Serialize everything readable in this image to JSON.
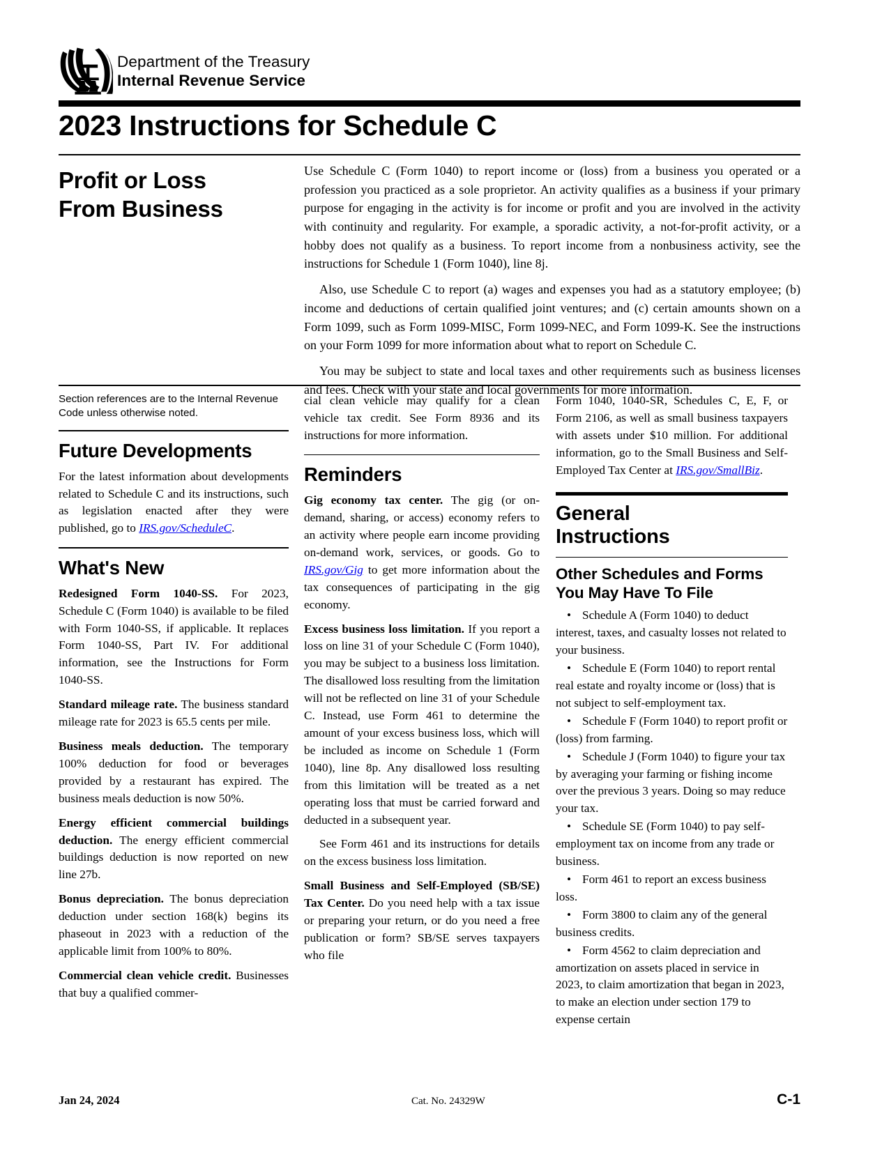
{
  "header": {
    "department": "Department of the Treasury",
    "agency": "Internal Revenue Service",
    "seal_icon": "irs-eagle-seal-icon"
  },
  "title": "2023 Instructions for Schedule C",
  "subtitle": "Profit or Loss\nFrom Business",
  "intro": {
    "p1": "Use Schedule C (Form 1040) to report income or (loss) from a business you operated or a profession you practiced as a sole proprietor. An activity qualifies as a business if your primary purpose for engaging in the activity is for income or profit and you are involved in the activity with continuity and regularity. For example, a sporadic activity, a not-for-profit activity, or a hobby does not qualify as a business. To report income from a nonbusiness activity, see the instructions for Schedule 1 (Form 1040), line 8j.",
    "p2": "Also, use Schedule C to report (a) wages and expenses you had as a statutory employee; (b) income and deductions of certain qualified joint ventures; and (c) certain amounts shown on a Form 1099, such as Form 1099-MISC, Form 1099-NEC, and Form 1099-K. See the instructions on your Form 1099 for more information about what to report on Schedule C.",
    "p3": "You may be subject to state and local taxes and other requirements such as business licenses and fees. Check with your state and local governments for more information."
  },
  "column1": {
    "section_note": "Section references are to the Internal Revenue Code unless otherwise noted.",
    "future_developments_heading": "Future Developments",
    "future_developments_text_before_link": "For the latest information about developments related to Schedule C and its instructions, such as legislation enacted after they were published, go to ",
    "future_developments_link": "IRS.gov/ScheduleC",
    "future_developments_text_after_link": ".",
    "whats_new_heading": "What's New",
    "items": [
      {
        "runin": "Redesigned Form 1040-SS.",
        "text": " For 2023, Schedule C (Form 1040) is available to be filed with Form 1040-SS, if applicable. It replaces Form 1040-SS, Part IV. For additional information, see the Instructions for Form 1040-SS."
      },
      {
        "runin": "Standard mileage rate.",
        "text": "  The business standard mileage rate for 2023 is 65.5 cents per mile."
      },
      {
        "runin": "Business meals deduction.",
        "text": " The temporary 100% deduction for food or beverages provided by a restaurant has expired. The business meals deduction is now 50%."
      },
      {
        "runin": "Energy efficient commercial buildings deduction.",
        "text": " The energy efficient commercial buildings deduction is now reported on new line 27b."
      },
      {
        "runin": "Bonus depreciation.",
        "text": " The bonus depreciation deduction under section 168(k) begins its phaseout in 2023 with a reduction of the applicable limit from 100% to 80%."
      },
      {
        "runin": "Commercial clean vehicle credit.",
        "text": " Businesses that buy a qualified commer-"
      }
    ]
  },
  "column2": {
    "continuation": "cial clean vehicle may qualify for a clean vehicle tax credit. See Form 8936 and its instructions for more information.",
    "reminders_heading": "Reminders",
    "items": [
      {
        "runin": "Gig economy tax center.",
        "text_before_link": " The gig (or on-demand, sharing, or access) economy refers to an activity where people earn income providing on-demand work, services, or goods. Go to ",
        "link": "IRS.gov/Gig",
        "text_after_link": " to get more information about the tax consequences of participating in the gig economy."
      },
      {
        "runin": "Excess business loss limitation.",
        "text": " If you report a loss on line 31 of your Schedule C (Form 1040), you may be subject to a business loss limitation. The disallowed loss resulting from the limitation will not be reflected on line 31 of your Schedule C. Instead, use Form 461 to determine the amount of your excess business loss, which will be included as income on Schedule 1 (Form 1040), line 8p. Any disallowed loss resulting from this limitation will be treated as a net operating loss that must be carried forward and deducted in a subsequent year."
      }
    ],
    "form461_paragraph": "See Form 461 and its instructions for details on the excess business loss limitation.",
    "sbse": {
      "runin": "Small Business and Self-Employed (SB/SE) Tax Center.",
      "text": " Do you need help with a tax issue or preparing your return, or do you need a free publication or form? SB/SE serves taxpayers who file"
    }
  },
  "column3": {
    "continuation_before_link": "Form 1040, 1040-SR, Schedules C, E, F, or Form 2106, as well as small business taxpayers with assets under $10 million. For additional information, go to the Small Business and Self-Employed Tax Center at ",
    "continuation_link": "IRS.gov/SmallBiz",
    "continuation_after_link": ".",
    "general_instructions_heading": "General\nInstructions",
    "other_schedules_heading": "Other Schedules and Forms\nYou May Have To File",
    "bullets": [
      "Schedule A (Form 1040) to deduct interest, taxes, and casualty losses not related to your business.",
      "Schedule E (Form 1040) to report rental real estate and royalty income or (loss) that is not subject to self-employment tax.",
      "Schedule F (Form 1040) to report profit or (loss) from farming.",
      "Schedule J (Form 1040) to figure your tax by averaging your farming or fishing income over the previous 3 years. Doing so may reduce your tax.",
      "Schedule SE (Form 1040) to pay self-employment tax on income from any trade or business.",
      "Form 461 to report an excess business loss.",
      "Form 3800 to claim any of the general business credits.",
      "Form 4562 to claim depreciation and amortization on assets placed in service in 2023, to claim amortization that began in 2023, to make an election under section 179 to expense certain"
    ],
    "bullet_glyph": "•"
  },
  "footer": {
    "date": "Jan 24, 2024",
    "catalog": "Cat. No. 24329W",
    "page": "C-1"
  }
}
